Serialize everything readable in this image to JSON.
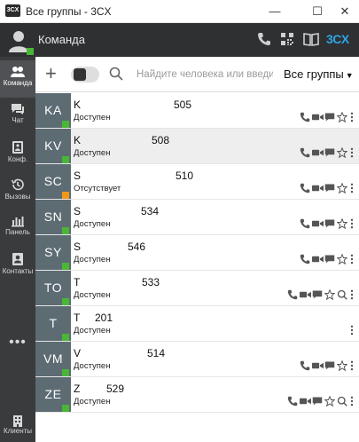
{
  "window": {
    "logo_text": "3CX",
    "title": "Все группы - 3CX",
    "minimize_glyph": "—",
    "maximize_glyph": "☐",
    "close_glyph": "✕"
  },
  "header": {
    "title": "Команда",
    "brand": "3CX",
    "icons": [
      "phone-icon",
      "qr-code-icon",
      "book-icon"
    ]
  },
  "sidebar": {
    "items": [
      {
        "label": "Команда",
        "icon": "team-icon",
        "active": true
      },
      {
        "label": "Чат",
        "icon": "chat-icon",
        "active": false
      },
      {
        "label": "Конф.",
        "icon": "conference-icon",
        "active": false
      },
      {
        "label": "Вызовы",
        "icon": "history-icon",
        "active": false
      },
      {
        "label": "Панель",
        "icon": "panel-icon",
        "active": false
      },
      {
        "label": "Контакты",
        "icon": "contacts-icon",
        "active": false
      }
    ],
    "more": "•••",
    "footer_label": "Клиенты"
  },
  "toolbar": {
    "plus": "+",
    "search_placeholder": "Найдите человека или введи",
    "search_value": "",
    "groups_label": "Все группы",
    "groups_caret": "▼"
  },
  "colors": {
    "status_available": "#4ab636",
    "status_away": "#f09819",
    "avatar_bg": "#5d6b73",
    "brand": "#2fa4e7"
  },
  "contacts": [
    {
      "initials": "KA",
      "name": "K",
      "ext": "505",
      "status": "Доступен",
      "state": "available",
      "selected": false,
      "actions": [
        "phone",
        "video",
        "chat",
        "star",
        "more"
      ]
    },
    {
      "initials": "KV",
      "name": "K",
      "ext": "508",
      "status": "Доступен",
      "state": "available",
      "selected": true,
      "actions": [
        "phone",
        "video",
        "chat",
        "star",
        "more"
      ]
    },
    {
      "initials": "SC",
      "name": "S",
      "ext": "510",
      "status": "Отсутствует",
      "state": "away",
      "selected": false,
      "actions": [
        "phone",
        "video",
        "chat",
        "star",
        "more"
      ]
    },
    {
      "initials": "SN",
      "name": "S",
      "ext": "534",
      "status": "Доступен",
      "state": "available",
      "selected": false,
      "actions": [
        "phone",
        "video",
        "chat",
        "star",
        "more"
      ]
    },
    {
      "initials": "SY",
      "name": "S",
      "ext": "546",
      "status": "Доступен",
      "state": "available",
      "selected": false,
      "actions": [
        "phone",
        "video",
        "chat",
        "star",
        "more"
      ]
    },
    {
      "initials": "TO",
      "name": "T",
      "ext": "533",
      "status": "Доступен",
      "state": "available",
      "selected": false,
      "actions": [
        "phone",
        "video",
        "chat",
        "star",
        "q",
        "more"
      ]
    },
    {
      "initials": "T",
      "name": "T",
      "ext": "201",
      "status": "Доступен",
      "state": "available",
      "selected": false,
      "actions": [
        "more"
      ]
    },
    {
      "initials": "VM",
      "name": "V",
      "ext": "514",
      "status": "Доступен",
      "state": "available",
      "selected": false,
      "actions": [
        "phone",
        "video",
        "chat",
        "star",
        "more"
      ]
    },
    {
      "initials": "ZE",
      "name": "Z",
      "ext": "529",
      "status": "Доступен",
      "state": "available",
      "selected": false,
      "actions": [
        "phone",
        "video",
        "chat",
        "star",
        "q",
        "more"
      ]
    }
  ]
}
